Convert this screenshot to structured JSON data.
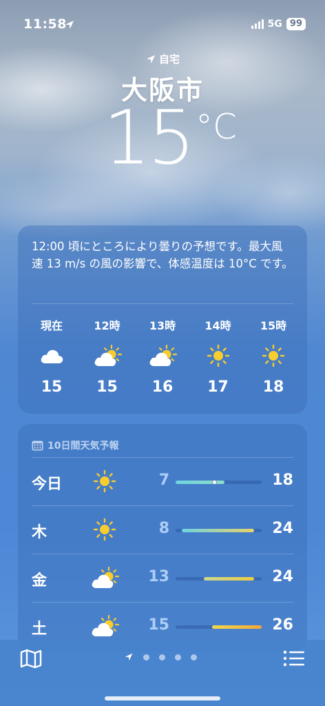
{
  "status": {
    "time": "11:58",
    "network": "5G",
    "battery": "99"
  },
  "header": {
    "location_label": "自宅",
    "city": "大阪市",
    "temperature": "15",
    "unit": "°C"
  },
  "hourly_card": {
    "summary": "12:00 頃にところにより曇りの予想です。最大風速 13 m/s の風の影響で、体感温度は 10°C です。",
    "hours": [
      {
        "label": "現在",
        "icon": "cloud-icon",
        "temp": "15"
      },
      {
        "label": "12時",
        "icon": "partly-sunny-icon",
        "temp": "15"
      },
      {
        "label": "13時",
        "icon": "partly-sunny-icon",
        "temp": "16"
      },
      {
        "label": "14時",
        "icon": "sun-icon",
        "temp": "17"
      },
      {
        "label": "15時",
        "icon": "sun-icon",
        "temp": "18"
      }
    ]
  },
  "daily_card": {
    "title": "10日間天気予報",
    "days": [
      {
        "day": "今日",
        "icon": "sun-icon",
        "low": "7",
        "high": "18",
        "range_start": 0.0,
        "range_end": 0.57,
        "current_marker": 0.45,
        "colors": [
          "#6fd3e0",
          "#8ee0c8"
        ]
      },
      {
        "day": "木",
        "icon": "sun-icon",
        "low": "8",
        "high": "24",
        "range_start": 0.07,
        "range_end": 0.91,
        "colors": [
          "#6fd3e0",
          "#e8d26a"
        ]
      },
      {
        "day": "金",
        "icon": "partly-sunny-icon",
        "low": "13",
        "high": "24",
        "range_start": 0.33,
        "range_end": 0.91,
        "colors": [
          "#c8d890",
          "#f0cc3e"
        ]
      },
      {
        "day": "土",
        "icon": "partly-sunny-icon",
        "low": "15",
        "high": "26",
        "range_start": 0.42,
        "range_end": 1.0,
        "colors": [
          "#f0d84a",
          "#f5a83a"
        ]
      }
    ]
  },
  "tab_bar": {
    "map_icon": "map-icon",
    "list_icon": "list-icon",
    "page_count": 4
  }
}
